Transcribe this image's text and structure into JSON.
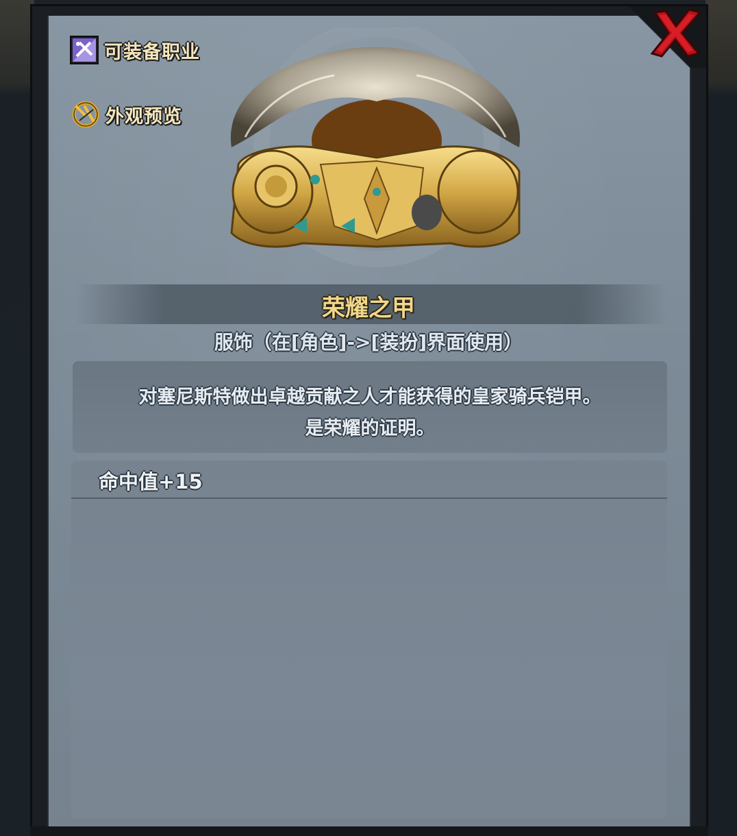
{
  "sidebar": {
    "class_label": "可装备职业",
    "preview_label": "外观预览"
  },
  "item": {
    "name": "荣耀之甲",
    "type_line": "服饰（在[角色]->[装扮]界面使用）",
    "description": [
      "对塞尼斯特做出卓越贡献之人才能获得的皇家骑兵铠甲。",
      "是荣耀的证明。"
    ],
    "stats": [
      "命中值+15"
    ]
  },
  "icons": {
    "close": "close-x-icon",
    "class": "class-icon",
    "preview": "preview-icon",
    "item_art": "fur-armor-image"
  },
  "colors": {
    "title": "#f1d88a",
    "close": "#c9121b",
    "panel": "#7d8b98"
  }
}
